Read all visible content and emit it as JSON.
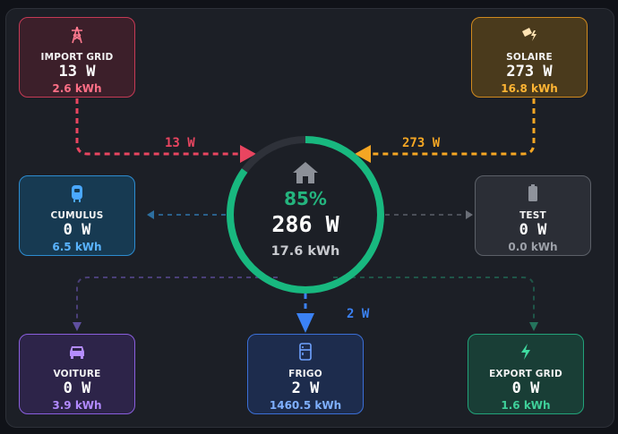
{
  "colors": {
    "grid": "#e94560",
    "solar": "#f5a623",
    "cumulus": "#2d8cd0",
    "test": "#8f939c",
    "car": "#8a5fdd",
    "fridge": "#3b82f6",
    "export": "#22a37a",
    "home_ring": "#18b87f"
  },
  "nodes": {
    "import_grid": {
      "label": "IMPORT GRID",
      "power": "13 W",
      "energy": "2.6 kWh",
      "icon": "transmission-tower-icon"
    },
    "solar": {
      "label": "SOLAIRE",
      "power": "273 W",
      "energy": "16.8 kWh",
      "icon": "solar-panel-icon"
    },
    "cumulus": {
      "label": "CUMULUS",
      "power": "0 W",
      "energy": "6.5 kWh",
      "icon": "water-heater-icon"
    },
    "test": {
      "label": "TEST",
      "power": "0 W",
      "energy": "0.0 kWh",
      "icon": "battery-icon"
    },
    "car": {
      "label": "VOITURE",
      "power": "0 W",
      "energy": "3.9 kWh",
      "icon": "car-icon"
    },
    "fridge": {
      "label": "FRIGO",
      "power": "2 W",
      "energy": "1460.5 kWh",
      "icon": "fridge-icon"
    },
    "export_grid": {
      "label": "EXPORT GRID",
      "power": "0 W",
      "energy": "1.6 kWh",
      "icon": "lightning-icon"
    }
  },
  "home": {
    "icon": "home-icon",
    "percent": "85%",
    "power": "286 W",
    "energy": "17.6 kWh",
    "ring_fraction": 0.85
  },
  "flows": {
    "grid_to_home": "13 W",
    "solar_to_home": "273 W",
    "home_to_fridge": "2 W"
  }
}
